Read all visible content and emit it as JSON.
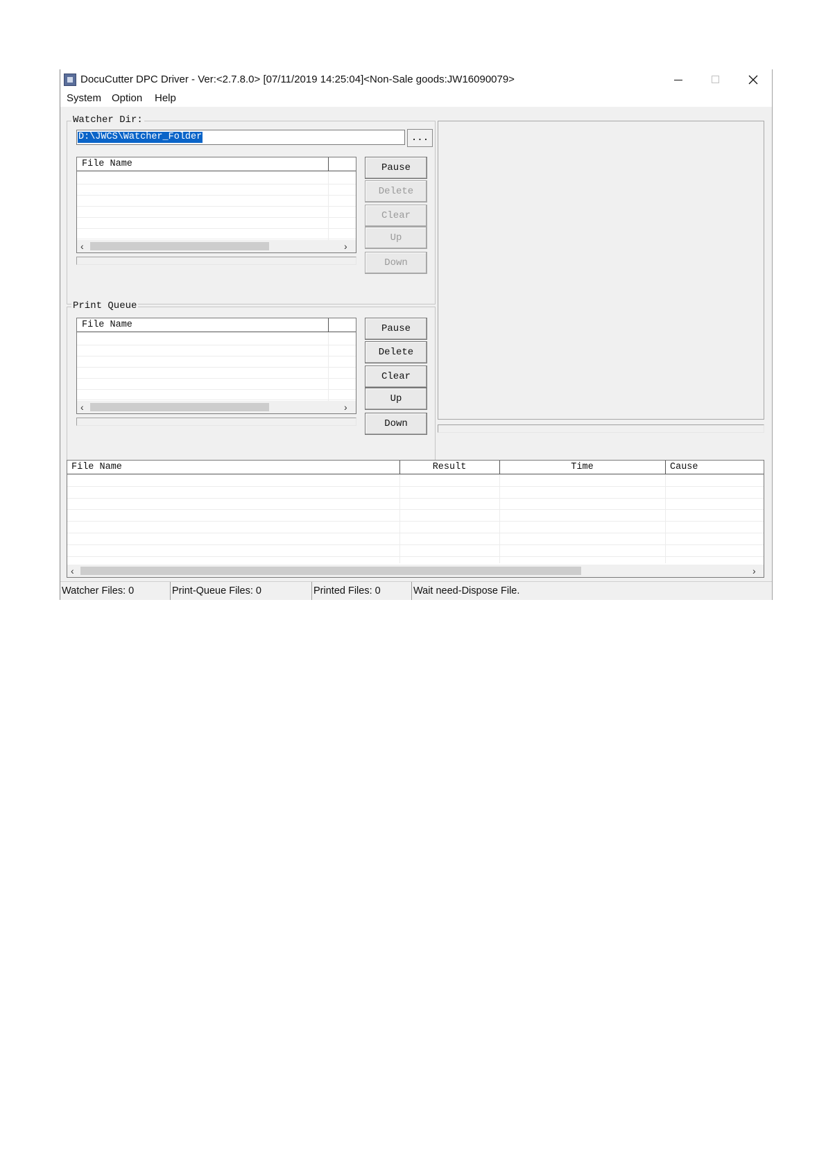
{
  "window": {
    "title": "DocuCutter DPC Driver - Ver:<2.7.8.0> [07/11/2019  14:25:04]<Non-Sale goods:JW16090079>"
  },
  "menu": [
    "System",
    "Option",
    "Help"
  ],
  "watcher": {
    "legend": "Watcher Dir:",
    "path": "D:\\JWCS\\Watcher_Folder",
    "browse_label": "...",
    "list_header": "File Name",
    "buttons": {
      "pause": "Pause",
      "delete": "Delete",
      "clear": "Clear",
      "up": "Up",
      "down": "Down"
    }
  },
  "print_queue": {
    "legend": "Print Queue",
    "list_header": "File Name",
    "buttons": {
      "pause": "Pause",
      "delete": "Delete",
      "clear": "Clear",
      "up": "Up",
      "down": "Down"
    }
  },
  "results": {
    "columns": [
      "File Name",
      "Result",
      "Time",
      "Cause"
    ]
  },
  "status": {
    "watcher_files": "Watcher Files: 0",
    "print_queue_files": "Print-Queue Files: 0",
    "printed_files": "Printed Files: 0",
    "message": "Wait need-Dispose File."
  },
  "icons": [
    "app-icon",
    "minimize-icon",
    "maximize-icon",
    "close-icon",
    "chevron-left-icon",
    "chevron-right-icon"
  ]
}
